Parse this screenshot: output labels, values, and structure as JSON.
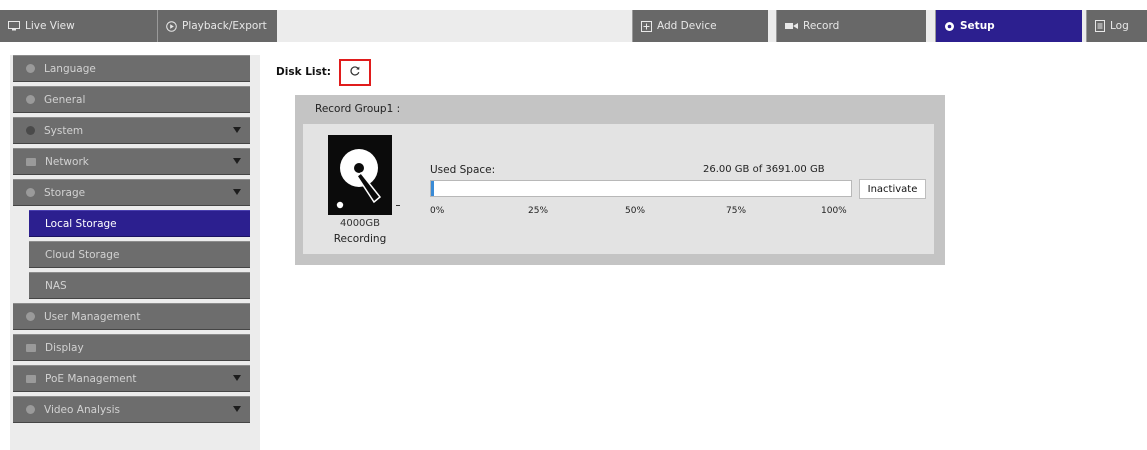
{
  "nav": {
    "tabs": [
      {
        "label": "Live View",
        "icon": "monitor-icon"
      },
      {
        "label": "Playback/Export",
        "icon": "play-circle-icon"
      },
      {
        "label": "Add Device",
        "icon": "add-device-icon"
      },
      {
        "label": "Record",
        "icon": "camera-record-icon"
      },
      {
        "label": "Setup",
        "icon": "gear-icon",
        "active": true
      },
      {
        "label": "Log",
        "icon": "document-icon"
      }
    ],
    "active_color": "#2c1f8f"
  },
  "sidebar": {
    "items": [
      {
        "label": "Language",
        "icon": "globe-icon"
      },
      {
        "label": "General",
        "icon": "info-icon"
      },
      {
        "label": "System",
        "icon": "gear-icon",
        "expandable": true
      },
      {
        "label": "Network",
        "icon": "network-icon",
        "expandable": true
      },
      {
        "label": "Storage",
        "icon": "storage-icon",
        "expandable": true
      },
      {
        "label": "Local Storage",
        "sub": true,
        "active": true
      },
      {
        "label": "Cloud Storage",
        "sub": true
      },
      {
        "label": "NAS",
        "sub": true
      },
      {
        "label": "User Management",
        "icon": "users-icon"
      },
      {
        "label": "Display",
        "icon": "display-icon"
      },
      {
        "label": "PoE Management",
        "icon": "poe-icon",
        "expandable": true
      },
      {
        "label": "Video Analysis",
        "icon": "analysis-icon",
        "expandable": true
      }
    ]
  },
  "main": {
    "disk_list_label": "Disk List:",
    "refresh_icon": "refresh-icon",
    "group": {
      "title": "Record Group1 :",
      "disk": {
        "icon": "hard-disk-icon",
        "size": "4000GB",
        "status": "Recording"
      },
      "used_space_label": "Used Space:",
      "used_space_value": "26.00 GB of 3691.00 GB",
      "used_fraction": 0.007,
      "ticks": [
        "0%",
        "25%",
        "50%",
        "75%",
        "100%"
      ],
      "inactivate_label": "Inactivate"
    }
  }
}
